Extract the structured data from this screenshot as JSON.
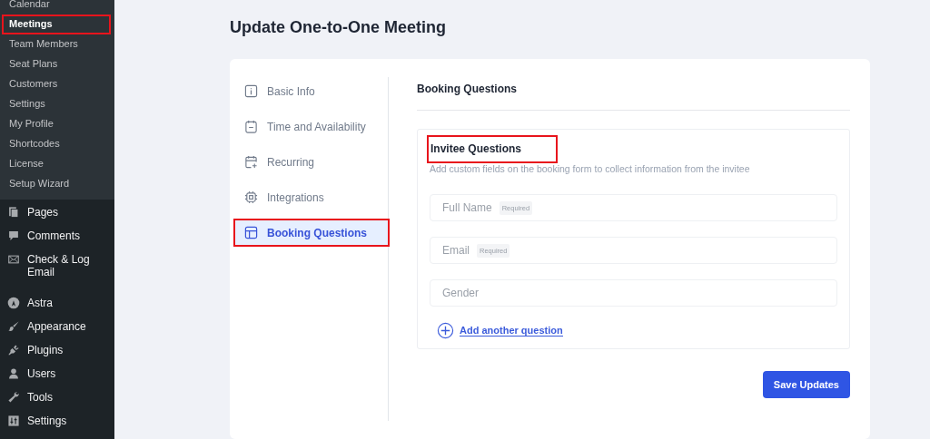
{
  "sidebar": {
    "submenu": [
      {
        "label": "Calendar",
        "selected": false,
        "highlighted": false
      },
      {
        "label": "Meetings",
        "selected": true,
        "highlighted": true
      },
      {
        "label": "Team Members",
        "selected": false,
        "highlighted": false
      },
      {
        "label": "Seat Plans",
        "selected": false,
        "highlighted": false
      },
      {
        "label": "Customers",
        "selected": false,
        "highlighted": false
      },
      {
        "label": "Settings",
        "selected": false,
        "highlighted": false
      },
      {
        "label": "My Profile",
        "selected": false,
        "highlighted": false
      },
      {
        "label": "Shortcodes",
        "selected": false,
        "highlighted": false
      },
      {
        "label": "License",
        "selected": false,
        "highlighted": false
      },
      {
        "label": "Setup Wizard",
        "selected": false,
        "highlighted": false
      }
    ],
    "menu": [
      {
        "label": "Pages"
      },
      {
        "label": "Comments"
      },
      {
        "label": "Check & Log Email"
      },
      {
        "label": "Astra"
      },
      {
        "label": "Appearance"
      },
      {
        "label": "Plugins"
      },
      {
        "label": "Users"
      },
      {
        "label": "Tools"
      },
      {
        "label": "Settings"
      }
    ]
  },
  "page_title": "Update One-to-One Meeting",
  "tabs": [
    {
      "label": "Basic Info",
      "selected": false,
      "highlighted": false
    },
    {
      "label": "Time and Availability",
      "selected": false,
      "highlighted": false
    },
    {
      "label": "Recurring",
      "selected": false,
      "highlighted": false
    },
    {
      "label": "Integrations",
      "selected": false,
      "highlighted": false
    },
    {
      "label": "Booking Questions",
      "selected": true,
      "highlighted": true
    }
  ],
  "section_title": "Booking Questions",
  "questions_panel": {
    "title": "Invitee Questions",
    "title_highlighted": true,
    "description": "Add custom fields on the booking form to collect information from the invitee",
    "fields": [
      {
        "label": "Full Name",
        "badge": "Required"
      },
      {
        "label": "Email",
        "badge": "Required"
      },
      {
        "label": "Gender"
      }
    ],
    "add_link": "Add another question"
  },
  "save_button": "Save Updates"
}
